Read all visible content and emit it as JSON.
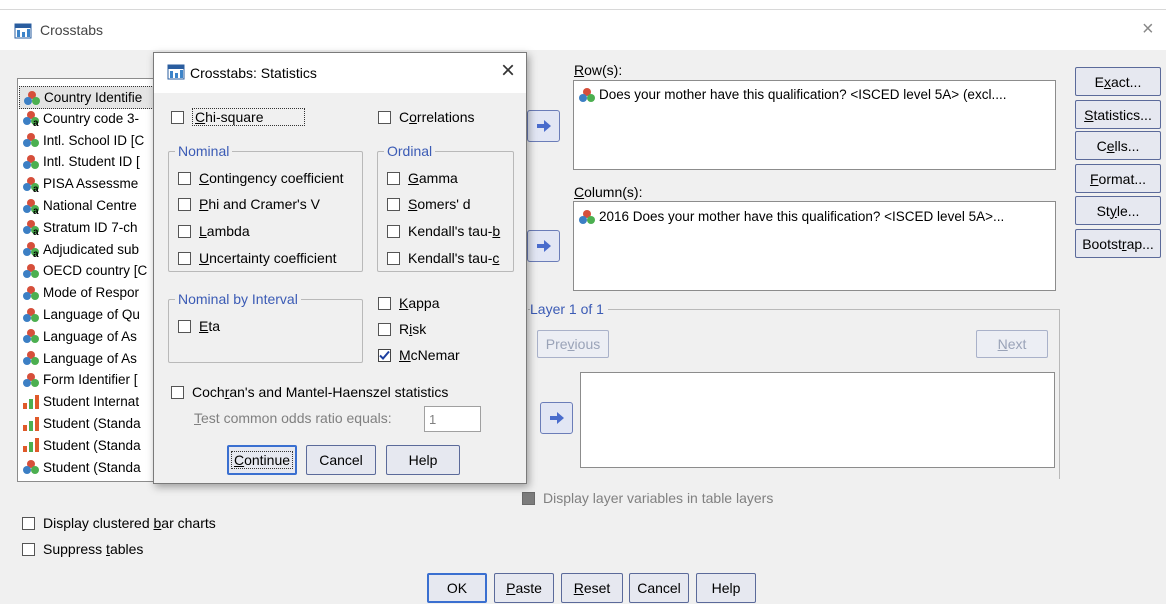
{
  "main_window": {
    "title": "Crosstabs",
    "close_glyph": "×",
    "variables": [
      {
        "label": "Country Identifie",
        "icon": "nominal-icon"
      },
      {
        "label": "Country code 3-",
        "icon": "string-nominal-icon"
      },
      {
        "label": "Intl. School ID [C",
        "icon": "nominal-icon"
      },
      {
        "label": "Intl. Student ID [",
        "icon": "nominal-icon"
      },
      {
        "label": "PISA Assessme",
        "icon": "string-nominal-icon"
      },
      {
        "label": "National Centre",
        "icon": "string-nominal-icon"
      },
      {
        "label": "Stratum ID 7-ch",
        "icon": "string-nominal-icon"
      },
      {
        "label": "Adjudicated sub",
        "icon": "string-nominal-icon"
      },
      {
        "label": "OECD country [C",
        "icon": "nominal-icon"
      },
      {
        "label": "Mode of Respor",
        "icon": "nominal-icon"
      },
      {
        "label": "Language of Qu",
        "icon": "nominal-icon"
      },
      {
        "label": "Language of As",
        "icon": "nominal-icon"
      },
      {
        "label": "Language of As",
        "icon": "nominal-icon"
      },
      {
        "label": "Form Identifier [",
        "icon": "nominal-icon"
      },
      {
        "label": "Student Internat",
        "icon": "scale-icon"
      },
      {
        "label": "Student (Standa",
        "icon": "scale-icon"
      },
      {
        "label": "Student (Standa",
        "icon": "scale-icon"
      },
      {
        "label": "Student (Standa",
        "icon": "nominal-icon"
      }
    ],
    "rows_label": "Row(s):",
    "rows_items": [
      "Does your mother have this qualification? <ISCED level 5A> (excl...."
    ],
    "columns_label": "Column(s):",
    "columns_items": [
      "2016 Does your mother have this qualification? <ISCED level 5A>..."
    ],
    "layer_label": "Layer 1 of 1",
    "previous_label": "Previous",
    "next_label": "Next",
    "display_layer_label": "Display layer variables in table layers",
    "clustered_bar_label": "Display clustered bar charts",
    "suppress_tables_label": "Suppress tables",
    "side_buttons": [
      "Exact...",
      "Statistics...",
      "Cells...",
      "Format...",
      "Style...",
      "Bootstrap..."
    ],
    "bottom_buttons": [
      "OK",
      "Paste",
      "Reset",
      "Cancel",
      "Help"
    ]
  },
  "statistics_dialog": {
    "title": "Crosstabs: Statistics",
    "close_glyph": "×",
    "chi_square": {
      "label": "Chi-square",
      "checked": false
    },
    "correlations": {
      "label": "Correlations",
      "checked": false
    },
    "nominal_group": "Nominal",
    "nominal_items": [
      {
        "label": "Contingency coefficient",
        "checked": false
      },
      {
        "label": "Phi and Cramer's V",
        "checked": false
      },
      {
        "label": "Lambda",
        "checked": false
      },
      {
        "label": "Uncertainty coefficient",
        "checked": false
      }
    ],
    "ordinal_group": "Ordinal",
    "ordinal_items": [
      {
        "label": "Gamma",
        "checked": false
      },
      {
        "label": "Somers' d",
        "checked": false
      },
      {
        "label": "Kendall's tau-b",
        "checked": false
      },
      {
        "label": "Kendall's tau-c",
        "checked": false
      }
    ],
    "nominal_by_interval_group": "Nominal by Interval",
    "eta": {
      "label": "Eta",
      "checked": false
    },
    "kappa": {
      "label": "Kappa",
      "checked": false
    },
    "risk": {
      "label": "Risk",
      "checked": false
    },
    "mcnemar": {
      "label": "McNemar",
      "checked": true
    },
    "cochran": {
      "label": "Cochran's and Mantel-Haenszel statistics",
      "checked": false
    },
    "odds_ratio_label": "Test common odds ratio equals:",
    "odds_ratio_value": "1",
    "buttons": [
      "Continue",
      "Cancel",
      "Help"
    ]
  }
}
